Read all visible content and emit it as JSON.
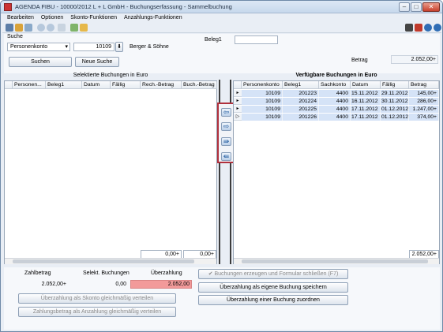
{
  "window": {
    "title": "AGENDA FIBU - 10000/2012 L + L GmbH - Buchungserfassung - Sammelbuchung"
  },
  "menu": [
    "Bearbeiten",
    "Optionen",
    "Skonto-Funktionen",
    "Anzahlungs-Funktionen"
  ],
  "search": {
    "label": "Suche",
    "type": "Personenkonto",
    "number": "10109",
    "name": "Berger & Söhne",
    "search_button": "Suchen",
    "new_search_button": "Neue Suche",
    "beleg_label": "Beleg1",
    "beleg_value": "",
    "betrag_label": "Betrag",
    "betrag_value": "2.052,00+"
  },
  "left_grid": {
    "title": "Selektierte Buchungen in Euro",
    "columns": [
      "Personen...",
      "Beleg1",
      "Datum",
      "Fällig",
      "Rech.-Betrag",
      "Buch.-Betrag"
    ],
    "total1": "0,00+",
    "total2": "0,00+"
  },
  "right_grid": {
    "title": "Verfügbare Buchungen in Euro",
    "columns": [
      "Personenkonto",
      "Beleg1",
      "Sachkonto",
      "Datum",
      "Fällig",
      "Betrag"
    ],
    "rows": [
      {
        "marker": "▸",
        "konto": "10109",
        "beleg": "201223",
        "sachkonto": "4400",
        "datum": "15.11.2012",
        "faellig": "29.11.2012",
        "betrag": "145,00+"
      },
      {
        "marker": "▸",
        "konto": "10109",
        "beleg": "201224",
        "sachkonto": "4400",
        "datum": "16.11.2012",
        "faellig": "30.11.2012",
        "betrag": "286,00+"
      },
      {
        "marker": "▸",
        "konto": "10109",
        "beleg": "201225",
        "sachkonto": "4400",
        "datum": "17.11.2012",
        "faellig": "01.12.2012",
        "betrag": "1.247,00+"
      },
      {
        "marker": "▷",
        "konto": "10109",
        "beleg": "201226",
        "sachkonto": "4400",
        "datum": "17.11.2012",
        "faellig": "01.12.2012",
        "betrag": "374,00+"
      }
    ],
    "total": "2.052,00+"
  },
  "summary": {
    "zahlbetrag_label": "Zahlbetrag",
    "zahlbetrag": "2.052,00+",
    "selekt_label": "Selekt. Buchungen",
    "selekt": "0,00",
    "ueber_label": "Überzahlung",
    "ueber": "2.052,00",
    "btn_skonto": "Überzahlung als Skonto gleichmäßig verteilen",
    "btn_anzahlung": "Zahlungsbetrag als Anzahlung gleichmäßig verteilen",
    "btn_close": "Buchungen erzeugen und Formular schließen (F7)",
    "btn_eigene": "Überzahlung als eigene Buchung speichern",
    "btn_zuordnen": "Überzahlung einer Buchung zuordnen"
  },
  "colors": {
    "overpayment_bg": "#f29a9a",
    "selected_row": "#d5e3f7",
    "highlight_border": "#b0303c"
  }
}
